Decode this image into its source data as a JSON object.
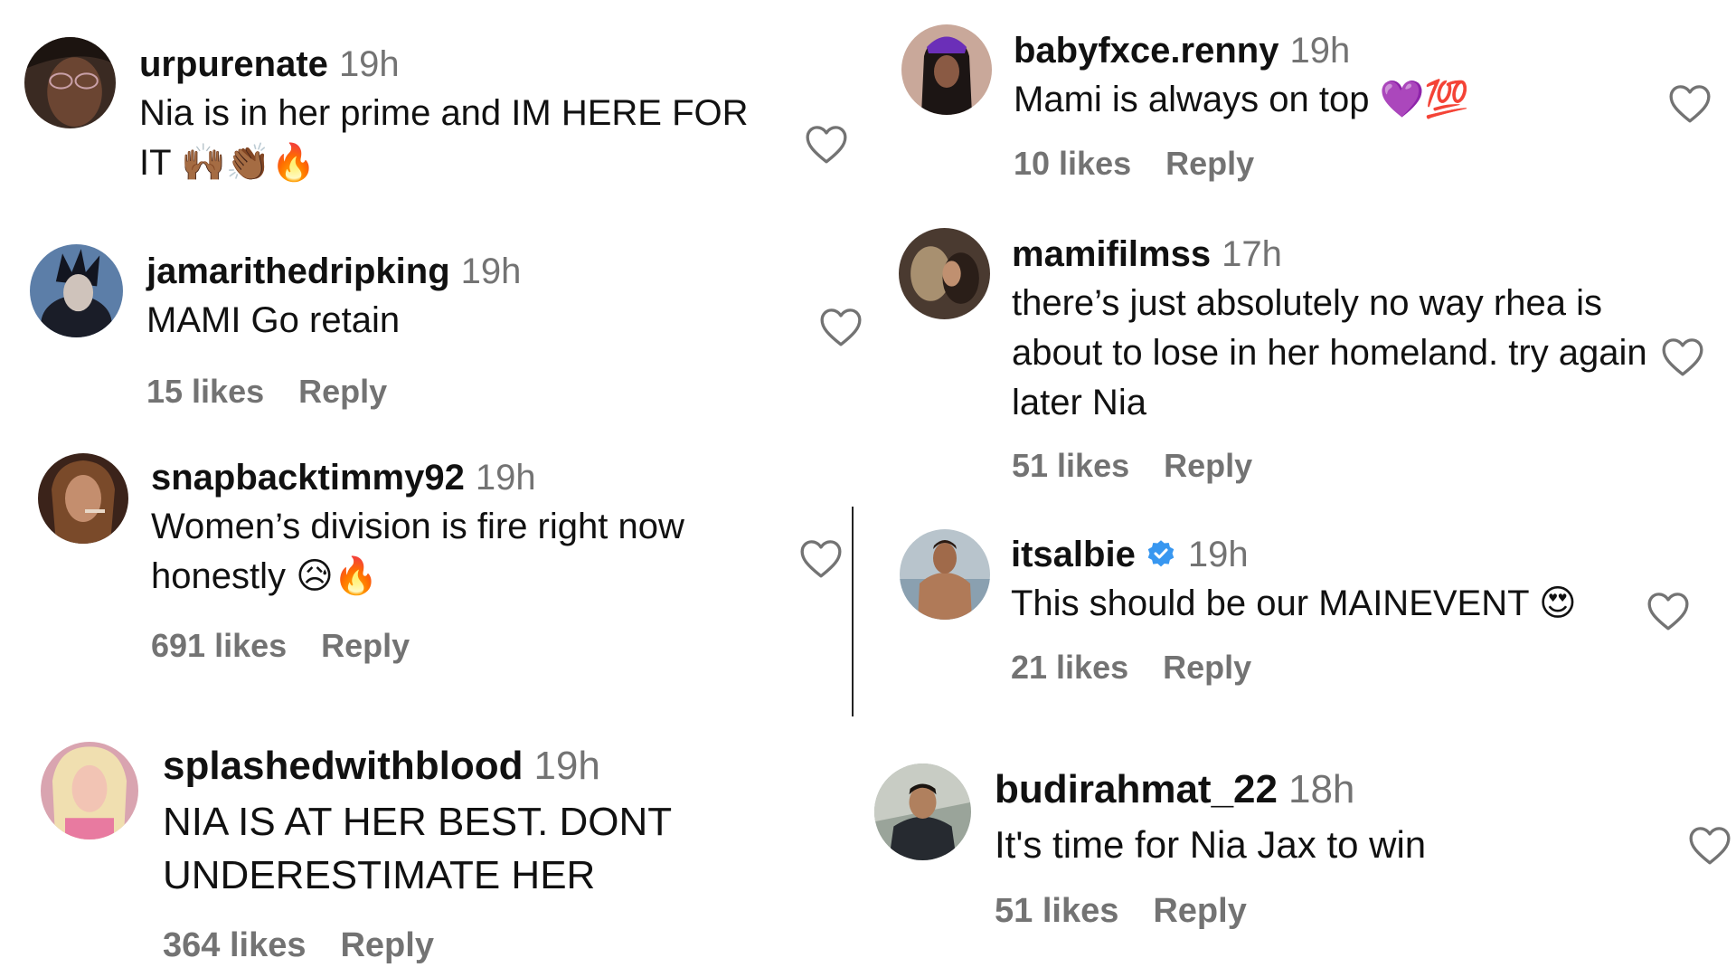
{
  "comments": [
    {
      "username": "urpurenate",
      "time": "19h",
      "text": "Nia is in her prime and IM HERE FOR IT 🙌🏾👏🏾🔥",
      "likes": "",
      "reply": ""
    },
    {
      "username": "jamarithedripking",
      "time": "19h",
      "text": "MAMI Go retain",
      "likes": "15 likes",
      "reply": "Reply"
    },
    {
      "username": "snapbacktimmy92",
      "time": "19h",
      "text": "Women’s division is fire right now honestly 😥🔥",
      "likes": "691 likes",
      "reply": "Reply"
    },
    {
      "username": "splashedwithblood",
      "time": "19h",
      "text": "NIA IS AT HER BEST. DONT UNDERESTIMATE HER",
      "likes": "364 likes",
      "reply": "Reply"
    },
    {
      "username": "babyfxce.renny",
      "time": "19h",
      "text": "Mami is always on top 💜💯",
      "likes": "10 likes",
      "reply": "Reply"
    },
    {
      "username": "mamifilmss",
      "time": "17h",
      "text": "there’s just absolutely no way rhea is about to lose in her homeland. try again later Nia",
      "likes": "51 likes",
      "reply": "Reply"
    },
    {
      "username": "itsalbie",
      "time": "19h",
      "text": "This should be our MAINEVENT 😍",
      "likes": "21 likes",
      "reply": "Reply",
      "verified": true
    },
    {
      "username": "budirahmat_22",
      "time": "18h",
      "text": "It's time for Nia Jax to win",
      "likes": "51 likes",
      "reply": "Reply"
    }
  ],
  "icons": {
    "heart": "heart-outline-icon",
    "verified": "verified-badge-icon"
  },
  "colors": {
    "text": "#111111",
    "muted": "#737373",
    "verified": "#3897f0"
  }
}
